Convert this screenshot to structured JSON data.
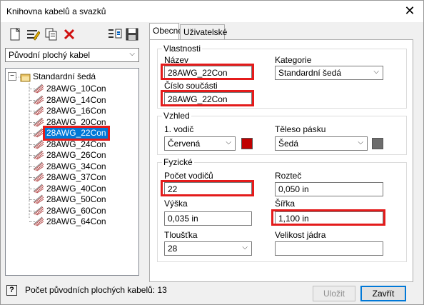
{
  "window": {
    "title": "Knihovna kabelů a svazků"
  },
  "toolbar": {
    "buttons": [
      {
        "name": "new-icon"
      },
      {
        "name": "edit-icon"
      },
      {
        "name": "copy-icon"
      },
      {
        "name": "delete-icon"
      },
      {
        "name": "import-icon"
      },
      {
        "name": "save-icon"
      }
    ]
  },
  "category_filter": {
    "value": "Původní plochý kabel"
  },
  "tree": {
    "root": "Standardní šedá",
    "items": [
      "28AWG_10Con",
      "28AWG_14Con",
      "28AWG_16Con",
      "28AWG_20Con",
      "28AWG_22Con",
      "28AWG_24Con",
      "28AWG_26Con",
      "28AWG_34Con",
      "28AWG_37Con",
      "28AWG_40Con",
      "28AWG_50Con",
      "28AWG_60Con",
      "28AWG_64Con"
    ],
    "selected_index": 4
  },
  "tabs": [
    {
      "label": "Obecné",
      "active": true
    },
    {
      "label": "Uživatelské",
      "active": false
    }
  ],
  "properties": {
    "group_label": "Vlastnosti",
    "name_label": "Název",
    "name_value": "28AWG_22Con",
    "category_label": "Kategorie",
    "category_value": "Standardní šedá",
    "part_number_label": "Číslo součásti",
    "part_number_value": "28AWG_22Con"
  },
  "appearance": {
    "group_label": "Vzhled",
    "wire1_label": "1. vodič",
    "wire1_value": "Červená",
    "wire1_color": "#c00000",
    "tape_label": "Těleso pásku",
    "tape_value": "Šedá",
    "tape_color": "#6d6d6d"
  },
  "physical": {
    "group_label": "Fyzické",
    "conductor_count_label": "Počet vodičů",
    "conductor_count_value": "22",
    "pitch_label": "Rozteč",
    "pitch_value": "0,050 in",
    "height_label": "Výška",
    "height_value": "0,035 in",
    "width_label": "Šířka",
    "width_value": "1,100 in",
    "thickness_label": "Tloušťka",
    "thickness_value": "28",
    "core_size_label": "Velikost jádra",
    "core_size_value": ""
  },
  "status": {
    "text": "Počet původních plochých kabelů: 13"
  },
  "buttons": {
    "save": "Uložit",
    "close": "Zavřít"
  },
  "highlight_color": "#e41b1b"
}
